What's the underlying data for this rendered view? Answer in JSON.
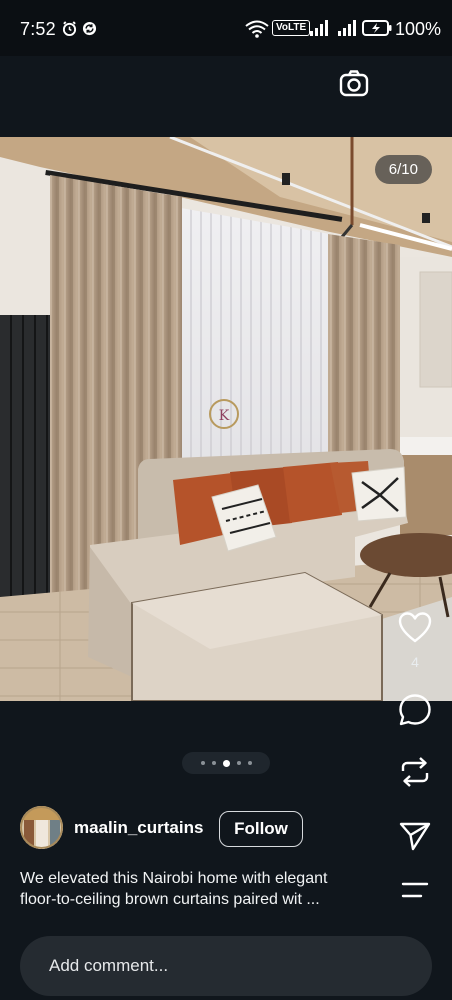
{
  "status_bar": {
    "time": "7:52",
    "network": "VoLTE",
    "battery": "100%"
  },
  "post": {
    "image_counter": "6/10",
    "carousel": {
      "total_dots": 5,
      "active_dot": 3
    },
    "like_count": "4",
    "author": {
      "username": "maalin_curtains",
      "follow_label": "Follow"
    },
    "caption_lines": [
      "We elevated this Nairobi home with elegant",
      "floor-to-ceiling brown curtains paired wit ..."
    ]
  },
  "comment": {
    "placeholder": "Add comment..."
  },
  "icons": {
    "top": "camera-icon",
    "rail": [
      "heart-icon",
      "comment-icon",
      "repost-icon",
      "share-icon",
      "more-icon"
    ]
  },
  "colors": {
    "background": "#10161c",
    "comment_bar": "#252b31",
    "curtain_brown": "#b39d86",
    "pillow_orange": "#b5532a",
    "sofa": "#d6cbbd"
  }
}
